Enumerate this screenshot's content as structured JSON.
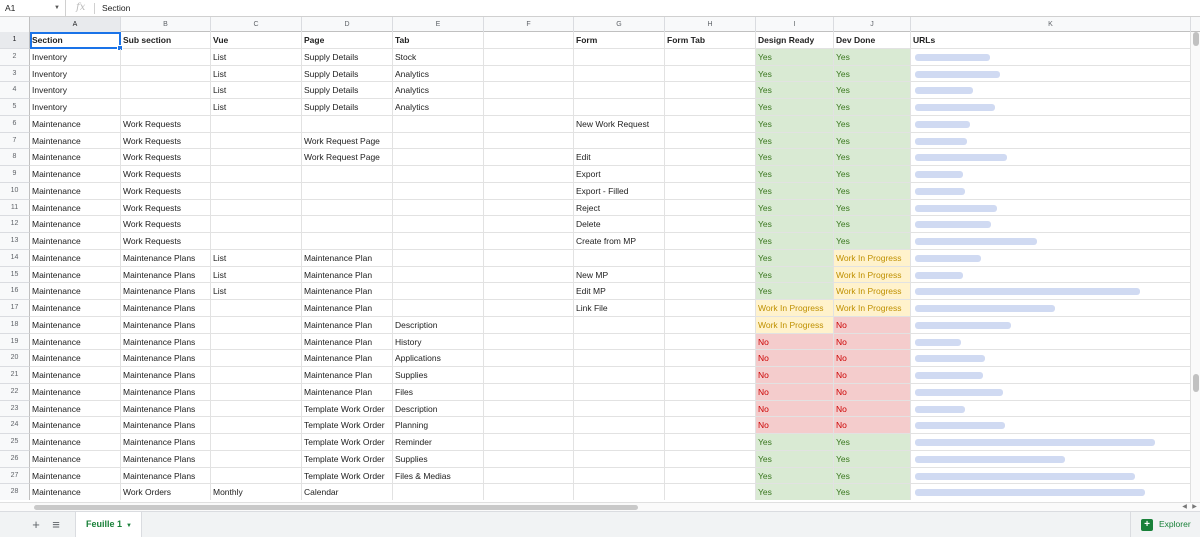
{
  "formula_bar": {
    "cell_ref": "A1",
    "fx_label": "fx",
    "value": "Section"
  },
  "columns": [
    "A",
    "B",
    "C",
    "D",
    "E",
    "F",
    "G",
    "H",
    "I",
    "J",
    "K"
  ],
  "header_row": {
    "row_num": "1",
    "cells": [
      "Section",
      "Sub section",
      "Vue",
      "Page",
      "Tab",
      "",
      "Form",
      "Form Tab",
      "Design Ready",
      "Dev Done",
      "URLs"
    ]
  },
  "rows": [
    {
      "n": "2",
      "a": "Inventory",
      "b": "",
      "c": "List",
      "d": "Supply Details",
      "e": "Stock",
      "g": "",
      "h": "",
      "i": "Yes",
      "j": "Yes",
      "iv": "yes",
      "jv": "yes",
      "url_w": 75
    },
    {
      "n": "3",
      "a": "Inventory",
      "b": "",
      "c": "List",
      "d": "Supply Details",
      "e": "Analytics",
      "g": "",
      "h": "",
      "i": "Yes",
      "j": "Yes",
      "iv": "yes",
      "jv": "yes",
      "url_w": 85
    },
    {
      "n": "4",
      "a": "Inventory",
      "b": "",
      "c": "List",
      "d": "Supply Details",
      "e": "Analytics",
      "g": "",
      "h": "",
      "i": "Yes",
      "j": "Yes",
      "iv": "yes",
      "jv": "yes",
      "url_w": 58
    },
    {
      "n": "5",
      "a": "Inventory",
      "b": "",
      "c": "List",
      "d": "Supply Details",
      "e": "Analytics",
      "g": "",
      "h": "",
      "i": "Yes",
      "j": "Yes",
      "iv": "yes",
      "jv": "yes",
      "url_w": 80
    },
    {
      "n": "6",
      "a": "Maintenance",
      "b": "Work Requests",
      "c": "",
      "d": "",
      "e": "",
      "g": "New Work Request",
      "h": "",
      "i": "Yes",
      "j": "Yes",
      "iv": "yes",
      "jv": "yes",
      "url_w": 55
    },
    {
      "n": "7",
      "a": "Maintenance",
      "b": "Work Requests",
      "c": "",
      "d": "Work Request Page",
      "e": "",
      "g": "",
      "h": "",
      "i": "Yes",
      "j": "Yes",
      "iv": "yes",
      "jv": "yes",
      "url_w": 52
    },
    {
      "n": "8",
      "a": "Maintenance",
      "b": "Work Requests",
      "c": "",
      "d": "Work Request Page",
      "e": "",
      "g": "Edit",
      "h": "",
      "i": "Yes",
      "j": "Yes",
      "iv": "yes",
      "jv": "yes",
      "url_w": 92
    },
    {
      "n": "9",
      "a": "Maintenance",
      "b": "Work Requests",
      "c": "",
      "d": "",
      "e": "",
      "g": "Export",
      "h": "",
      "i": "Yes",
      "j": "Yes",
      "iv": "yes",
      "jv": "yes",
      "url_w": 48
    },
    {
      "n": "10",
      "a": "Maintenance",
      "b": "Work Requests",
      "c": "",
      "d": "",
      "e": "",
      "g": "Export - Filled",
      "h": "",
      "i": "Yes",
      "j": "Yes",
      "iv": "yes",
      "jv": "yes",
      "url_w": 50
    },
    {
      "n": "11",
      "a": "Maintenance",
      "b": "Work Requests",
      "c": "",
      "d": "",
      "e": "",
      "g": "Reject",
      "h": "",
      "i": "Yes",
      "j": "Yes",
      "iv": "yes",
      "jv": "yes",
      "url_w": 82
    },
    {
      "n": "12",
      "a": "Maintenance",
      "b": "Work Requests",
      "c": "",
      "d": "",
      "e": "",
      "g": "Delete",
      "h": "",
      "i": "Yes",
      "j": "Yes",
      "iv": "yes",
      "jv": "yes",
      "url_w": 76
    },
    {
      "n": "13",
      "a": "Maintenance",
      "b": "Work Requests",
      "c": "",
      "d": "",
      "e": "",
      "g": "Create from MP",
      "h": "",
      "i": "Yes",
      "j": "Yes",
      "iv": "yes",
      "jv": "yes",
      "url_w": 122
    },
    {
      "n": "14",
      "a": "Maintenance",
      "b": "Maintenance Plans",
      "c": "List",
      "d": "Maintenance Plan",
      "e": "",
      "g": "",
      "h": "",
      "i": "Yes",
      "j": "Work In Progress",
      "iv": "yes",
      "jv": "wip",
      "url_w": 66
    },
    {
      "n": "15",
      "a": "Maintenance",
      "b": "Maintenance Plans",
      "c": "List",
      "d": "Maintenance Plan",
      "e": "",
      "g": "New MP",
      "h": "",
      "i": "Yes",
      "j": "Work In Progress",
      "iv": "yes",
      "jv": "wip",
      "url_w": 48
    },
    {
      "n": "16",
      "a": "Maintenance",
      "b": "Maintenance Plans",
      "c": "List",
      "d": "Maintenance Plan",
      "e": "",
      "g": "Edit MP",
      "h": "",
      "i": "Yes",
      "j": "Work In Progress",
      "iv": "yes",
      "jv": "wip",
      "url_w": 225
    },
    {
      "n": "17",
      "a": "Maintenance",
      "b": "Maintenance Plans",
      "c": "",
      "d": "Maintenance Plan",
      "e": "",
      "g": "Link File",
      "h": "",
      "i": "Work In Progress",
      "j": "Work In Progress",
      "iv": "wip",
      "jv": "wip",
      "url_w": 140
    },
    {
      "n": "18",
      "a": "Maintenance",
      "b": "Maintenance Plans",
      "c": "",
      "d": "Maintenance Plan",
      "e": "Description",
      "g": "",
      "h": "",
      "i": "Work In Progress",
      "j": "No",
      "iv": "wip",
      "jv": "no",
      "url_w": 96
    },
    {
      "n": "19",
      "a": "Maintenance",
      "b": "Maintenance Plans",
      "c": "",
      "d": "Maintenance Plan",
      "e": "History",
      "g": "",
      "h": "",
      "i": "No",
      "j": "No",
      "iv": "no",
      "jv": "no",
      "url_w": 46
    },
    {
      "n": "20",
      "a": "Maintenance",
      "b": "Maintenance Plans",
      "c": "",
      "d": "Maintenance Plan",
      "e": "Applications",
      "g": "",
      "h": "",
      "i": "No",
      "j": "No",
      "iv": "no",
      "jv": "no",
      "url_w": 70
    },
    {
      "n": "21",
      "a": "Maintenance",
      "b": "Maintenance Plans",
      "c": "",
      "d": "Maintenance Plan",
      "e": "Supplies",
      "g": "",
      "h": "",
      "i": "No",
      "j": "No",
      "iv": "no",
      "jv": "no",
      "url_w": 68
    },
    {
      "n": "22",
      "a": "Maintenance",
      "b": "Maintenance Plans",
      "c": "",
      "d": "Maintenance Plan",
      "e": "Files",
      "g": "",
      "h": "",
      "i": "No",
      "j": "No",
      "iv": "no",
      "jv": "no",
      "url_w": 88
    },
    {
      "n": "23",
      "a": "Maintenance",
      "b": "Maintenance Plans",
      "c": "",
      "d": "Template Work Order",
      "e": "Description",
      "g": "",
      "h": "",
      "i": "No",
      "j": "No",
      "iv": "no",
      "jv": "no",
      "url_w": 50
    },
    {
      "n": "24",
      "a": "Maintenance",
      "b": "Maintenance Plans",
      "c": "",
      "d": "Template Work Order",
      "e": "Planning",
      "g": "",
      "h": "",
      "i": "No",
      "j": "No",
      "iv": "no",
      "jv": "no",
      "url_w": 90
    },
    {
      "n": "25",
      "a": "Maintenance",
      "b": "Maintenance Plans",
      "c": "",
      "d": "Template Work Order",
      "e": "Reminder",
      "g": "",
      "h": "",
      "i": "Yes",
      "j": "Yes",
      "iv": "yes",
      "jv": "yes",
      "url_w": 240
    },
    {
      "n": "26",
      "a": "Maintenance",
      "b": "Maintenance Plans",
      "c": "",
      "d": "Template Work Order",
      "e": "Supplies",
      "g": "",
      "h": "",
      "i": "Yes",
      "j": "Yes",
      "iv": "yes",
      "jv": "yes",
      "url_w": 150
    },
    {
      "n": "27",
      "a": "Maintenance",
      "b": "Maintenance Plans",
      "c": "",
      "d": "Template Work Order",
      "e": "Files & Medias",
      "g": "",
      "h": "",
      "i": "Yes",
      "j": "Yes",
      "iv": "yes",
      "jv": "yes",
      "url_w": 220
    },
    {
      "n": "28",
      "a": "Maintenance",
      "b": "Work Orders",
      "c": "Monthly",
      "d": "Calendar",
      "e": "",
      "g": "",
      "h": "",
      "i": "Yes",
      "j": "Yes",
      "iv": "yes",
      "jv": "yes",
      "url_w": 230
    }
  ],
  "sheet_bar": {
    "add": "+",
    "menu": "≡",
    "sheet_name": "Feuille 1",
    "explore_label": "Explorer"
  },
  "colors": {
    "green_bg": "#d9ead3",
    "yellow_bg": "#fff2cc",
    "red_bg": "#f4cccc",
    "tab_green": "#188038",
    "selection": "#1a73e8"
  }
}
